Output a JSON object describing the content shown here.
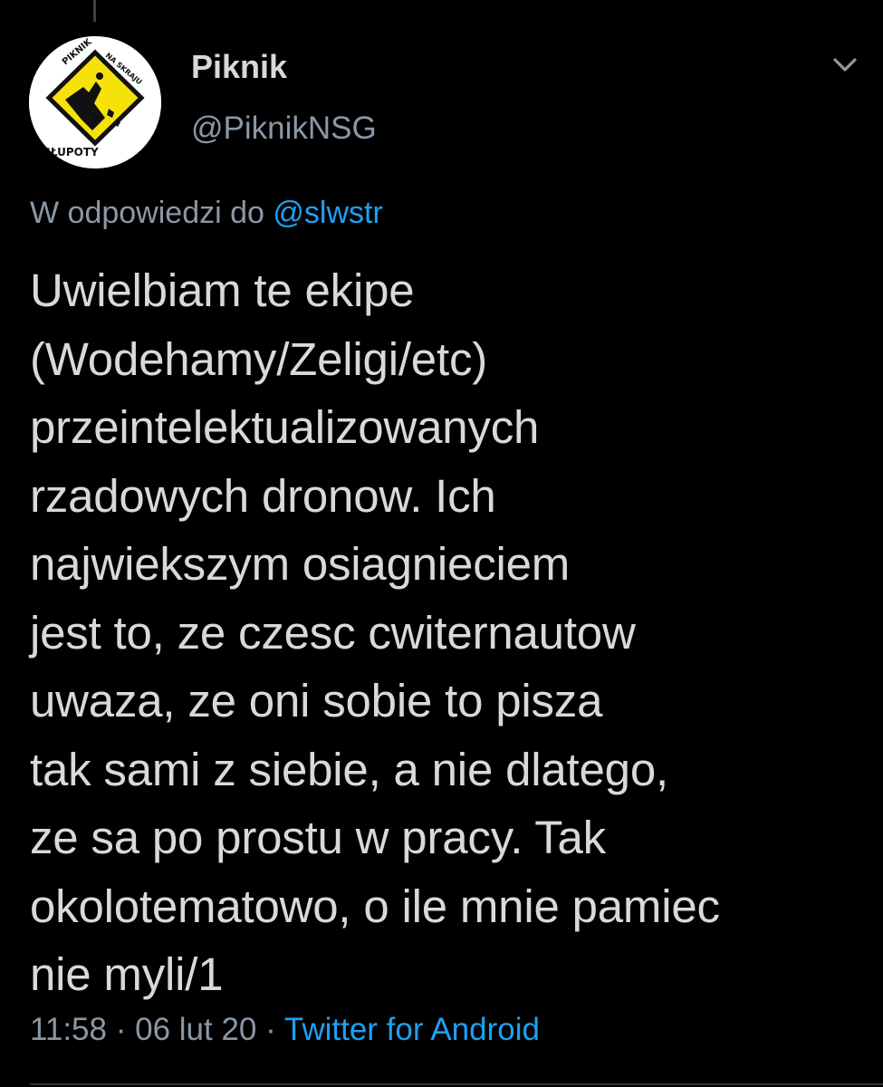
{
  "tweet": {
    "author": {
      "display_name": "Piknik",
      "handle": "@PiknikNSG",
      "avatar_text_top": "PIKNIK",
      "avatar_text_right": "NA SKRAJU",
      "avatar_text_bottom": "GŁUPOTY"
    },
    "reply_to": {
      "prefix": "W odpowiedzi do",
      "mention": "@slwstr"
    },
    "text_lines": [
      "Uwielbiam te ekipe",
      "(Wodehamy/Zeligi/etc)",
      "przeintelektualizowanych",
      "rzadowych dronow. Ich",
      "najwiekszym osiagnieciem",
      "jest to, ze czesc cwiternautow",
      "uwaza, ze oni sobie to pisza",
      "tak sami z siebie, a nie dlatego,",
      "ze sa po prostu w pracy. Tak",
      "okolotematowo, o ile mnie pamiec",
      "nie myli/1"
    ],
    "time": "11:58",
    "date": "06 lut 20",
    "separator": "·",
    "source": "Twitter for Android"
  },
  "icons": {
    "menu": "chevron-down-icon"
  },
  "colors": {
    "background": "#000000",
    "text": "#d9d9d9",
    "secondary_text": "#8b98a5",
    "accent": "#1da1f2",
    "avatar_sign": "#f5e20a"
  }
}
